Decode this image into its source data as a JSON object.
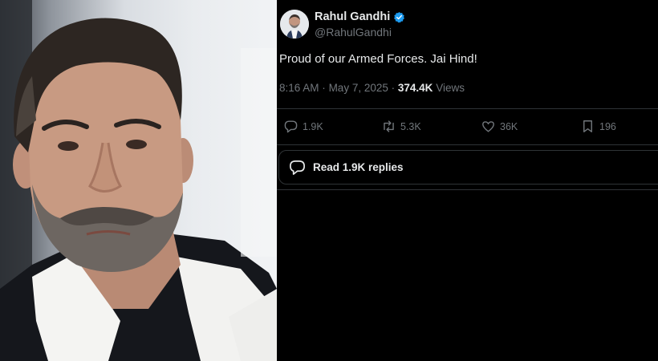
{
  "tweet": {
    "author_name": "Rahul Gandhi",
    "handle": "@RahulGandhi",
    "text": "Proud of our Armed Forces. Jai Hind!",
    "time": "8:16 AM",
    "separator": "·",
    "date": "May 7, 2025",
    "views_count": "374.4K",
    "views_label": "Views"
  },
  "actions": {
    "replies": "1.9K",
    "reposts": "5.3K",
    "likes": "36K",
    "bookmarks": "196"
  },
  "read_replies": {
    "label": "Read 1.9K replies"
  },
  "colors": {
    "background": "#000000",
    "text_primary": "#e7e9ea",
    "text_secondary": "#71767b",
    "border": "#2f3336",
    "verified": "#1d9bf0"
  },
  "icons": {
    "verified": "verified-badge-icon",
    "reply": "speech-bubble-icon",
    "repost": "repost-arrows-icon",
    "like": "heart-icon",
    "bookmark": "bookmark-icon",
    "read_replies": "speech-bubble-icon"
  }
}
